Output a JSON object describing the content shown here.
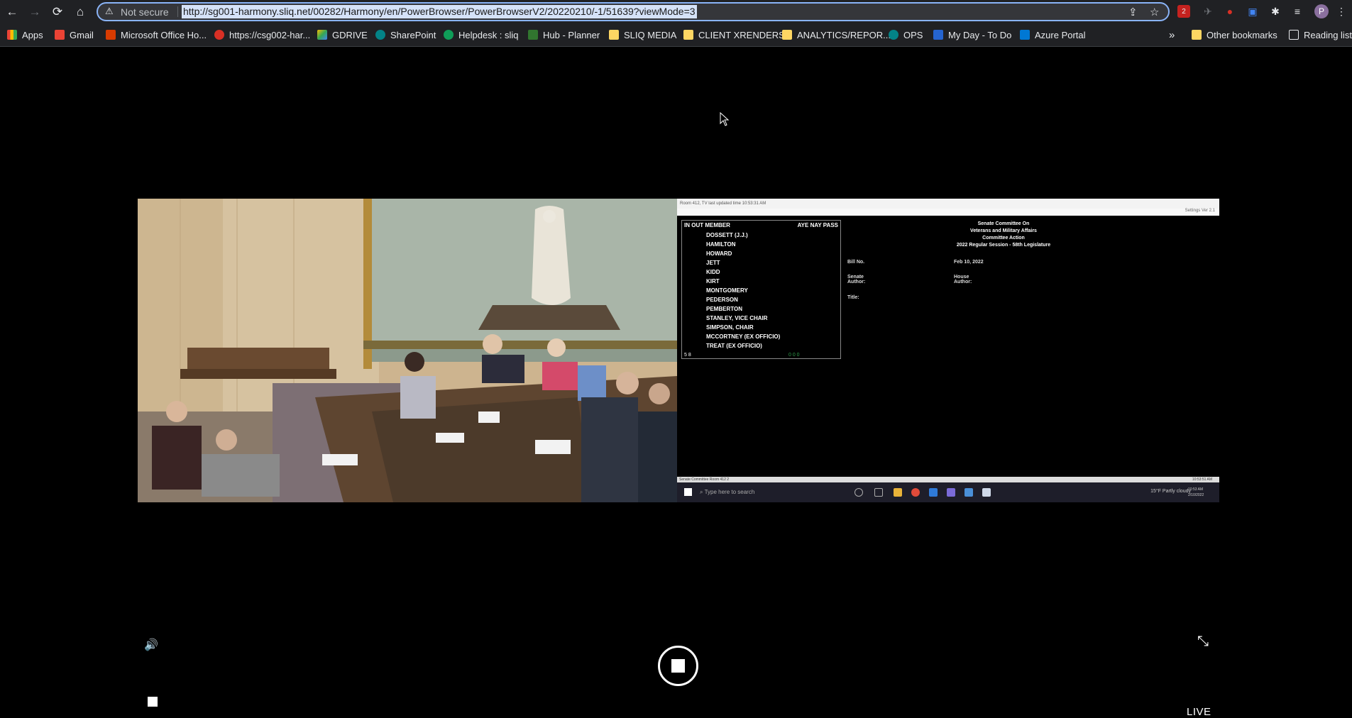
{
  "browser": {
    "security_label": "Not secure",
    "url": "http://sg001-harmony.sliq.net/00282/Harmony/en/PowerBrowser/PowerBrowserV2/20220210/-1/51639?viewMode=3",
    "extension_badge": "2",
    "profile_initial": "P"
  },
  "bookmarks": {
    "apps": "Apps",
    "items": [
      "Gmail",
      "Microsoft Office Ho...",
      "https://csg002-har...",
      "GDRIVE",
      "SharePoint",
      "Helpdesk : sliq",
      "Hub - Planner",
      "SLIQ MEDIA",
      "CLIENT XRENDERS",
      "ANALYTICS/REPOR...",
      "OPS",
      "My Day - To Do",
      "Azure Portal"
    ],
    "overflow": "»",
    "other": "Other bookmarks",
    "reading_list": "Reading list"
  },
  "video": {
    "screen_title": "Room 412, TV last updated time 10:53:31 AM",
    "roster_header_left": "IN OUT MEMBER",
    "roster_header_right": "AYE NAY PASS",
    "members": [
      "DOSSETT (J.J.)",
      "HAMILTON",
      "HOWARD",
      "JETT",
      "KIDD",
      "KIRT",
      "MONTGOMERY",
      "PEDERSON",
      "PEMBERTON",
      "STANLEY, VICE CHAIR",
      "SIMPSON, CHAIR",
      "MCCORTNEY (EX OFFICIO)",
      "TREAT (EX OFFICIO)"
    ],
    "counts_in_out": "5  8",
    "counts_votes": "0  0  0",
    "committee_line1": "Senate Committee On",
    "committee_line2": "Veterans and Military Affairs",
    "committee_line3": "Committee Action",
    "committee_line4": "2022 Regular Session - 58th Legislature",
    "bill_label": "Bill No.",
    "date_value": "Feb 10, 2022",
    "senate_author_label": "Senate Author:",
    "house_author_label": "House Author:",
    "title_label": "Title:",
    "status_left": "Senate Committee Room 412 2",
    "status_right": "10:53:51 AM",
    "taskbar_search": "Type here to search",
    "taskbar_weather": "15°F  Partly cloudy",
    "taskbar_time": "10:53 AM 2/10/2022",
    "settings_label": "Settings Ver 2.1"
  },
  "player": {
    "live_label": "LIVE",
    "volume_icon": "speaker-icon",
    "exit_fullscreen_icon": "collapse-icon"
  }
}
